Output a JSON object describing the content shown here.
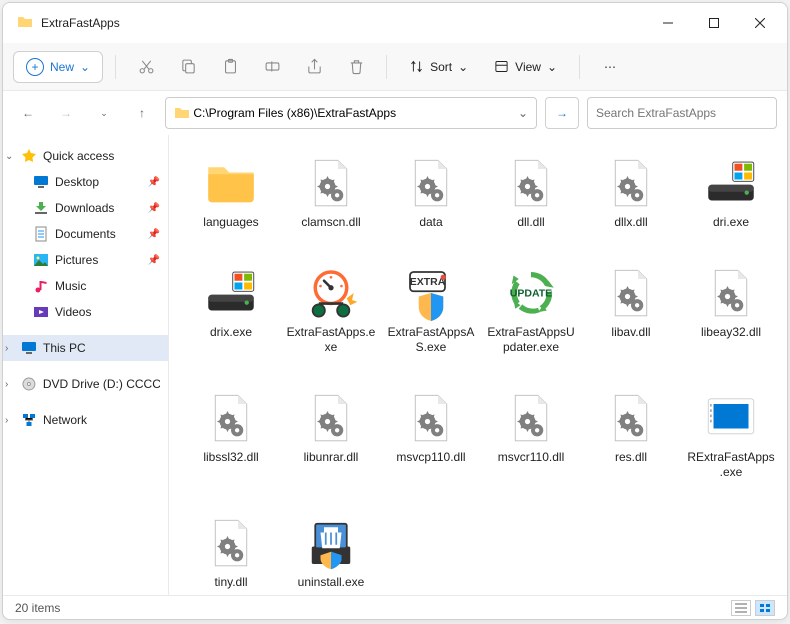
{
  "window": {
    "title": "ExtraFastApps"
  },
  "toolbar": {
    "new": "New",
    "sort": "Sort",
    "view": "View"
  },
  "address": {
    "path": "C:\\Program Files (x86)\\ExtraFastApps"
  },
  "search": {
    "placeholder": "Search ExtraFastApps"
  },
  "nav": {
    "quick": "Quick access",
    "desktop": "Desktop",
    "downloads": "Downloads",
    "documents": "Documents",
    "pictures": "Pictures",
    "music": "Music",
    "videos": "Videos",
    "thispc": "This PC",
    "dvd": "DVD Drive (D:) CCCC",
    "network": "Network"
  },
  "files": [
    {
      "name": "languages",
      "type": "folder"
    },
    {
      "name": "clamscn.dll",
      "type": "dll"
    },
    {
      "name": "data",
      "type": "dll"
    },
    {
      "name": "dll.dll",
      "type": "dll"
    },
    {
      "name": "dllx.dll",
      "type": "dll"
    },
    {
      "name": "dri.exe",
      "type": "exe-drive"
    },
    {
      "name": "drix.exe",
      "type": "exe-drive"
    },
    {
      "name": "ExtraFastApps.exe",
      "type": "exe-speed"
    },
    {
      "name": "ExtraFastAppsAS.exe",
      "type": "exe-shield"
    },
    {
      "name": "ExtraFastAppsUpdater.exe",
      "type": "exe-update"
    },
    {
      "name": "libav.dll",
      "type": "dll"
    },
    {
      "name": "libeay32.dll",
      "type": "dll"
    },
    {
      "name": "libssl32.dll",
      "type": "dll"
    },
    {
      "name": "libunrar.dll",
      "type": "dll"
    },
    {
      "name": "msvcp110.dll",
      "type": "dll"
    },
    {
      "name": "msvcr110.dll",
      "type": "dll"
    },
    {
      "name": "res.dll",
      "type": "dll"
    },
    {
      "name": "RExtraFastApps.exe",
      "type": "exe-screen"
    },
    {
      "name": "tiny.dll",
      "type": "dll"
    },
    {
      "name": "uninstall.exe",
      "type": "exe-uninstall"
    }
  ],
  "status": {
    "count": "20 items"
  }
}
